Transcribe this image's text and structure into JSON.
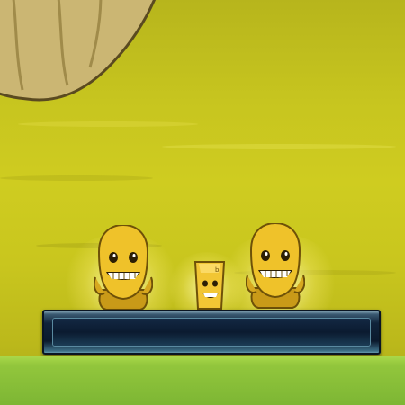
{
  "scene": {
    "background_color": "#c7c51f",
    "ground_color": "#92c63c",
    "platform_color": "#0b1a2d",
    "characters": [
      {
        "name": "golden-idol-left",
        "color": "#e8b820"
      },
      {
        "name": "golden-cup-center",
        "color": "#f0c030"
      },
      {
        "name": "golden-idol-right",
        "color": "#e8b820"
      }
    ]
  }
}
